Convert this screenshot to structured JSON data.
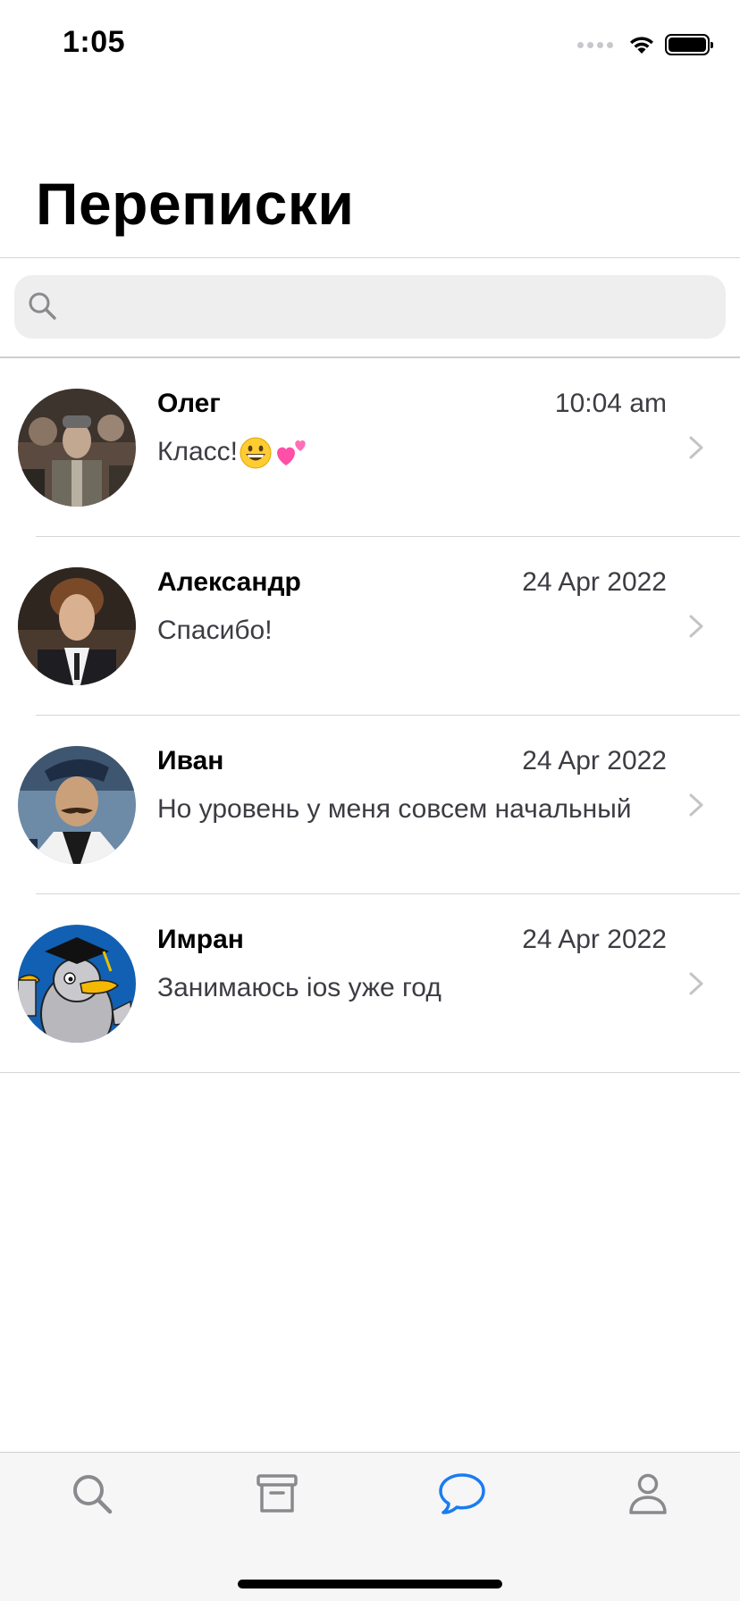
{
  "status_bar": {
    "time": "1:05",
    "icons": [
      "cellular-signal-icon",
      "wifi-icon",
      "battery-icon"
    ]
  },
  "page": {
    "title": "Переписки"
  },
  "search": {
    "placeholder": "",
    "value": "",
    "icon": "search-icon"
  },
  "chats": [
    {
      "name": "Олег",
      "date": "10:04 am",
      "preview": "Класс!",
      "preview_emoji": [
        "grinning-face-icon",
        "two-hearts-icon"
      ]
    },
    {
      "name": "Александр",
      "date": "24 Apr 2022",
      "preview": "Спасибо!"
    },
    {
      "name": "Иван",
      "date": "24 Apr 2022",
      "preview": "Но уровень у меня совсем начальный"
    },
    {
      "name": "Имран",
      "date": "24 Apr 2022",
      "preview": "Занимаюсь ios уже год"
    }
  ],
  "tab_bar": {
    "items": [
      {
        "icon": "search-icon",
        "active": false
      },
      {
        "icon": "archive-box-icon",
        "active": false
      },
      {
        "icon": "chat-bubble-icon",
        "active": true
      },
      {
        "icon": "person-icon",
        "active": false
      }
    ],
    "active_color": "#1a7cf2",
    "inactive_color": "#8a8a8e"
  }
}
